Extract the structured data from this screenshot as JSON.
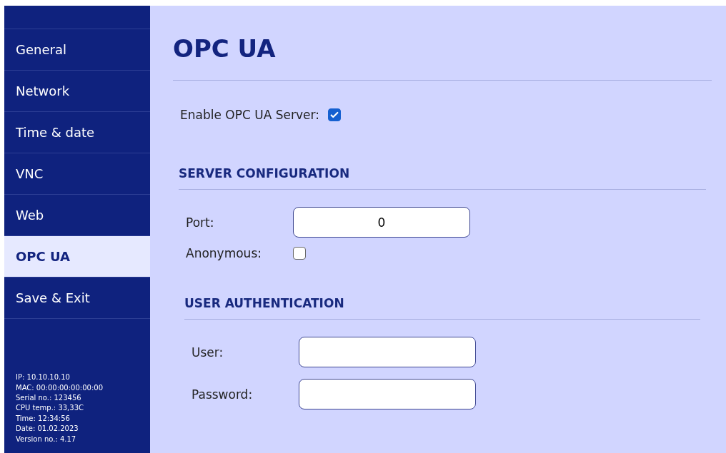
{
  "sidebar": {
    "items": [
      {
        "label": "General",
        "selected": false
      },
      {
        "label": "Network",
        "selected": false
      },
      {
        "label": "Time & date",
        "selected": false
      },
      {
        "label": "VNC",
        "selected": false
      },
      {
        "label": "Web",
        "selected": false
      },
      {
        "label": "OPC UA",
        "selected": true
      },
      {
        "label": "Save & Exit",
        "selected": false
      }
    ],
    "info": [
      "IP: 10.10.10.10",
      "MAC: 00:00:00:00:00:00",
      "Serial no.: 123456",
      "CPU temp.: 33,33C",
      "Time: 12:34:56",
      "Date: 01.02.2023",
      "Version no.: 4.17"
    ]
  },
  "page": {
    "title": "OPC UA",
    "enable": {
      "label": "Enable OPC UA Server:",
      "checked": true
    },
    "server_configuration": {
      "heading": "SERVER CONFIGURATION",
      "port": {
        "label": "Port:",
        "value": "0"
      },
      "anonymous": {
        "label": "Anonymous:",
        "checked": false
      }
    },
    "user_authentication": {
      "heading": "USER AUTHENTICATION",
      "user": {
        "label": "User:"
      },
      "password": {
        "label": "Password:"
      }
    }
  }
}
